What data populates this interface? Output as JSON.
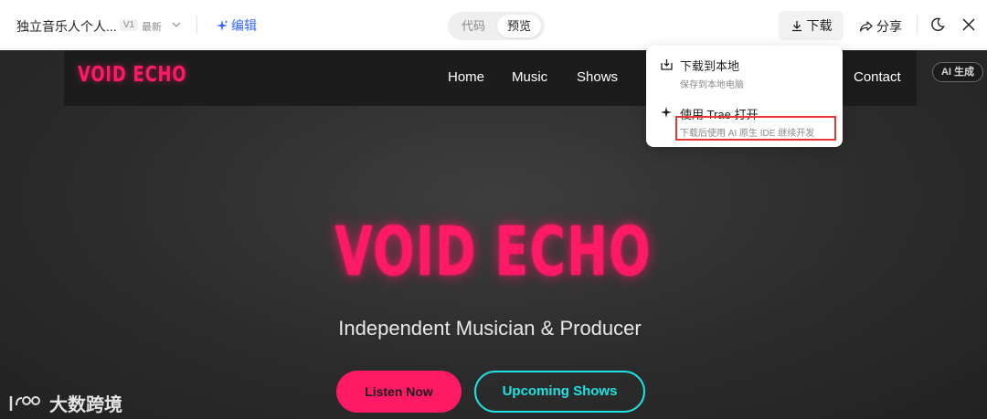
{
  "topbar": {
    "doc_title": "独立音乐人个人...",
    "version": "V1",
    "latest": "最新",
    "edit_label": "编辑",
    "tabs": {
      "code": "代码",
      "preview": "预览"
    },
    "download_label": "下载",
    "share_label": "分享"
  },
  "dropdown": {
    "items": [
      {
        "title": "下载到本地",
        "desc": "保存到本地电脑"
      },
      {
        "title": "使用 Trae 打开",
        "desc": "下载后使用 AI 原生 IDE 继续开发"
      }
    ]
  },
  "site": {
    "logo": "VOID ECHO",
    "nav": [
      "Home",
      "Music",
      "Shows",
      "Contact"
    ],
    "ai_badge": "AI 生成",
    "hero_title": "VOID ECHO",
    "hero_subtitle": "Independent Musician & Producer",
    "cta_primary": "Listen Now",
    "cta_secondary": "Upcoming Shows"
  },
  "watermark": {
    "text": "大数跨境"
  },
  "colors": {
    "accent_pink": "#ff1a66",
    "accent_cyan": "#1ee3e3",
    "link_blue": "#3366ff",
    "highlight_red": "#e53935"
  }
}
